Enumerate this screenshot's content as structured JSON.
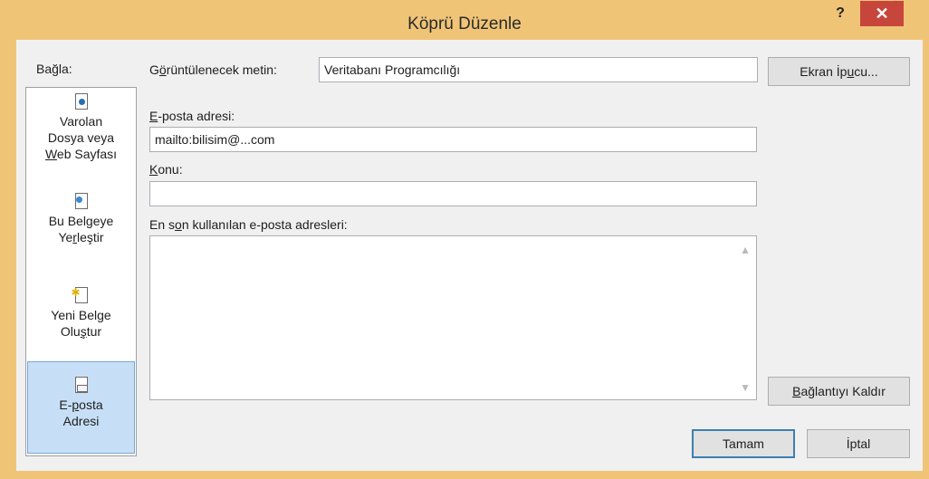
{
  "window": {
    "title": "Köprü Düzenle",
    "help_label": "?",
    "close_label": "✕"
  },
  "linkbar": {
    "heading": "Bağla:",
    "items": [
      {
        "line1": "Varolan",
        "line2": "Dosya veya",
        "line3_accel": "W",
        "line3_rest": "eb Sayfası",
        "icon": "existing-file-icon"
      },
      {
        "line1": "Bu Belgeye",
        "line2_pre": "Ye",
        "line2_accel": "r",
        "line2_post": "leştir",
        "icon": "place-in-document-icon"
      },
      {
        "line1": "Yeni Belge",
        "line2_pre": "Olu",
        "line2_accel": "ş",
        "line2_post": "tur",
        "icon": "new-document-icon"
      },
      {
        "line1_pre": "E-",
        "line1_accel": "p",
        "line1_post": "osta",
        "line2": "Adresi",
        "icon": "email-address-icon",
        "selected": true
      }
    ]
  },
  "display_text": {
    "label_pre": "G",
    "label_accel": "ö",
    "label_post": "rüntülenecek metin:",
    "value": "Veritabanı Programcılığı"
  },
  "screentip_button": {
    "pre": "Ekran İp",
    "accel": "u",
    "post": "cu..."
  },
  "email": {
    "label_accel": "E",
    "label_rest": "-posta adresi:",
    "value": "mailto:bilisim@...com"
  },
  "subject": {
    "label_accel": "K",
    "label_rest": "onu:",
    "value": ""
  },
  "recent": {
    "label_pre": "En s",
    "label_accel": "o",
    "label_post": "n kullanılan e-posta adresleri:"
  },
  "remove_link_button": {
    "accel": "B",
    "rest": "ağlantıyı Kaldır"
  },
  "ok_button": "Tamam",
  "cancel_button": "İptal",
  "colors": {
    "frame": "#f0c477",
    "close": "#c7463c",
    "selected_link": "#c7dff6"
  }
}
